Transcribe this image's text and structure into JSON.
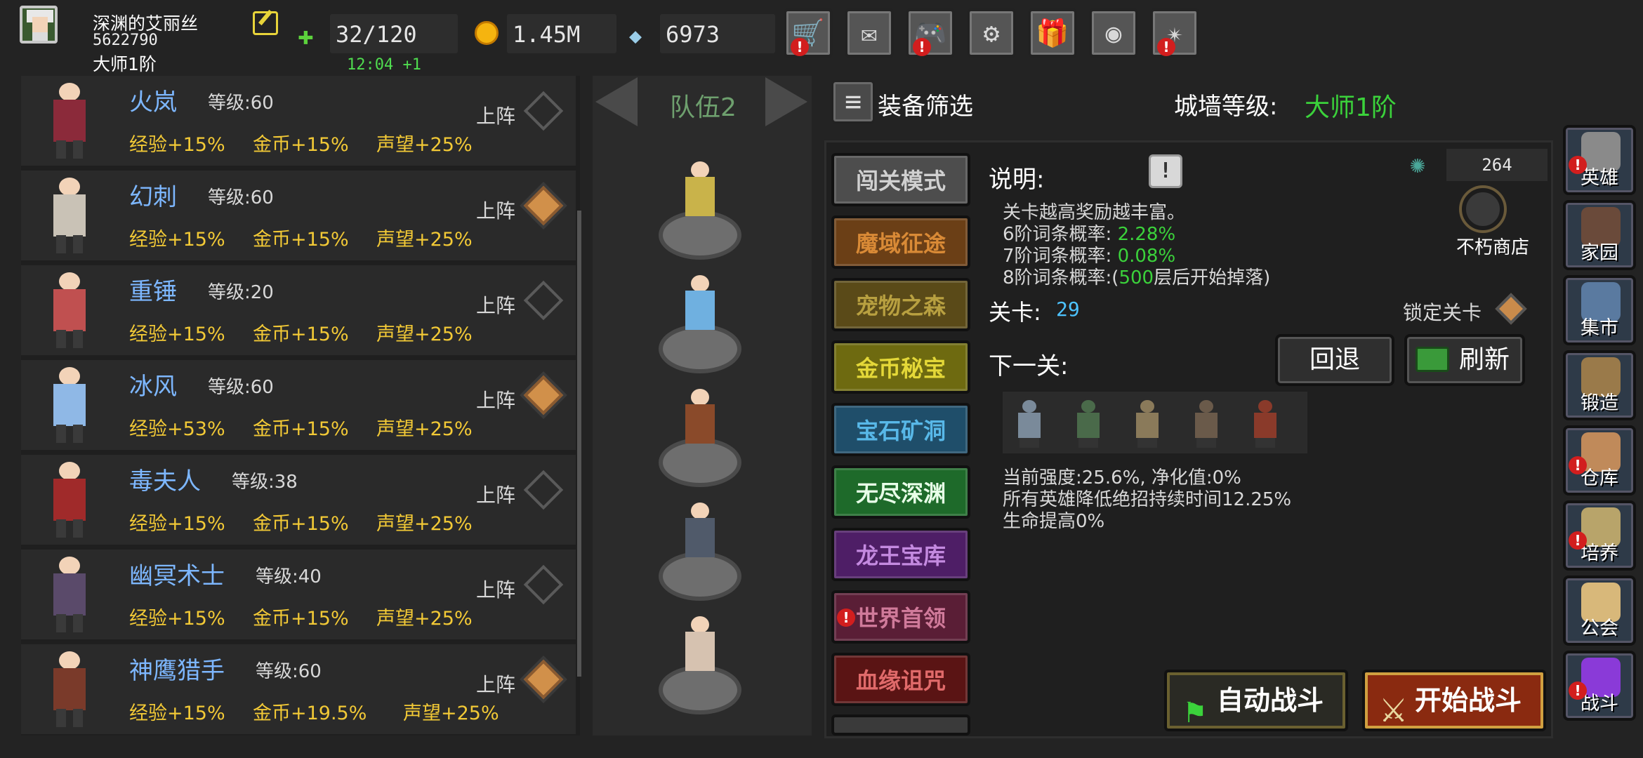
{
  "player": {
    "name": "深渊的艾丽丝",
    "id": "5622790",
    "rank": "大师1阶"
  },
  "resources": {
    "stamina": "32/120",
    "stamina_timer": "12:04 +1",
    "gold": "1.45M",
    "gems": "6973"
  },
  "top_buttons": [
    {
      "name": "shop",
      "icon": "cart-icon",
      "alert": true
    },
    {
      "name": "mail",
      "icon": "mail-icon",
      "alert": false
    },
    {
      "name": "gamepad",
      "icon": "gamepad-icon",
      "alert": true
    },
    {
      "name": "settings",
      "icon": "gear-icon",
      "alert": false
    },
    {
      "name": "gift",
      "icon": "gift-icon",
      "alert": false
    },
    {
      "name": "color-wheel",
      "icon": "wheel-icon",
      "alert": false
    },
    {
      "name": "fireworks",
      "icon": "firework-icon",
      "alert": true
    }
  ],
  "heroes": [
    {
      "name": "火岚",
      "level": "等级:60",
      "exp": "经验+15%",
      "gold": "金币+15%",
      "fame": "声望+25%",
      "deploy": "上阵",
      "deployed": false,
      "color": "#8b2a3a"
    },
    {
      "name": "幻刺",
      "level": "等级:60",
      "exp": "经验+15%",
      "gold": "金币+15%",
      "fame": "声望+25%",
      "deploy": "上阵",
      "deployed": true,
      "color": "#c9c2b6"
    },
    {
      "name": "重锤",
      "level": "等级:20",
      "exp": "经验+15%",
      "gold": "金币+15%",
      "fame": "声望+25%",
      "deploy": "上阵",
      "deployed": false,
      "color": "#c05050"
    },
    {
      "name": "冰风",
      "level": "等级:60",
      "exp": "经验+53%",
      "gold": "金币+15%",
      "fame": "声望+25%",
      "deploy": "上阵",
      "deployed": true,
      "color": "#8fb8e6"
    },
    {
      "name": "毒夫人",
      "level": "等级:38",
      "exp": "经验+15%",
      "gold": "金币+15%",
      "fame": "声望+25%",
      "deploy": "上阵",
      "deployed": false,
      "color": "#a02a2a"
    },
    {
      "name": "幽冥术士",
      "level": "等级:40",
      "exp": "经验+15%",
      "gold": "金币+15%",
      "fame": "声望+25%",
      "deploy": "上阵",
      "deployed": false,
      "color": "#5a4a6a"
    },
    {
      "name": "神鹰猎手",
      "level": "等级:60",
      "exp": "经验+15%",
      "gold": "金币+19.5%",
      "fame": "声望+25%",
      "deploy": "上阵",
      "deployed": true,
      "color": "#7a3a2a"
    }
  ],
  "team": {
    "title": "队伍2",
    "members": [
      "#c9b34a",
      "#6fb0e0",
      "#8a4a2a",
      "#505a6a",
      "#d6c2b0"
    ]
  },
  "filter": {
    "label": "装备筛选"
  },
  "wall": {
    "label": "城墙等级:",
    "value": "大师1阶"
  },
  "modes": [
    {
      "label": "闯关模式",
      "bg": "#4d4d4d",
      "fg": "#d0d0d0"
    },
    {
      "label": "魔域征途",
      "bg": "#6b3f16",
      "fg": "#d98a36"
    },
    {
      "label": "宠物之森",
      "bg": "#5a4a18",
      "fg": "#b8a040"
    },
    {
      "label": "金币秘宝",
      "bg": "#6e6a10",
      "fg": "#e4d838"
    },
    {
      "label": "宝石矿洞",
      "bg": "#1f4e6a",
      "fg": "#58b8e8"
    },
    {
      "label": "无尽深渊",
      "bg": "#1e6a2a",
      "fg": "#e8ffe8"
    },
    {
      "label": "龙王宝库",
      "bg": "#4e1e66",
      "fg": "#c48ae0"
    },
    {
      "label": "世界首领",
      "bg": "#5a1e36",
      "fg": "#d07a9a"
    },
    {
      "label": "血缘诅咒",
      "bg": "#5a1414",
      "fg": "#e06a6a"
    }
  ],
  "description": {
    "title": "说明:",
    "line1": "关卡越高奖励越丰富。",
    "l2_prefix": "6阶词条概率:",
    "l2_value": "2.28%",
    "l3_prefix": "7阶词条概率:",
    "l3_value": "0.08%",
    "l4_prefix": "8阶词条概率:(",
    "l4_value": "500",
    "l4_suffix": "层后开始掉落)"
  },
  "shop": {
    "count": "264",
    "label": "不朽商店"
  },
  "stage": {
    "label": "关卡:",
    "value": "29",
    "lock_label": "锁定关卡"
  },
  "next": {
    "label": "下一关:",
    "back": "回退",
    "refresh": "刷新"
  },
  "stage_info": {
    "strength": "当前强度:25.6%, 净化值:0%",
    "debuff": "所有英雄降低绝招持续时间12.25%",
    "life": "生命提高0%"
  },
  "battle": {
    "auto": "自动战斗",
    "start": "开始战斗"
  },
  "sidebar": [
    {
      "label": "英雄",
      "alert": true,
      "color": "#8a8a8a"
    },
    {
      "label": "家园",
      "alert": false,
      "color": "#6a4a3a"
    },
    {
      "label": "集市",
      "alert": false,
      "color": "#5a7aa0"
    },
    {
      "label": "锻造",
      "alert": false,
      "color": "#9a7a4a"
    },
    {
      "label": "仓库",
      "alert": true,
      "color": "#c08a5a"
    },
    {
      "label": "培养",
      "alert": true,
      "color": "#b8a46a"
    },
    {
      "label": "公会",
      "alert": false,
      "color": "#d8b87a"
    },
    {
      "label": "战斗",
      "alert": true,
      "color": "#8a3ad8"
    }
  ]
}
